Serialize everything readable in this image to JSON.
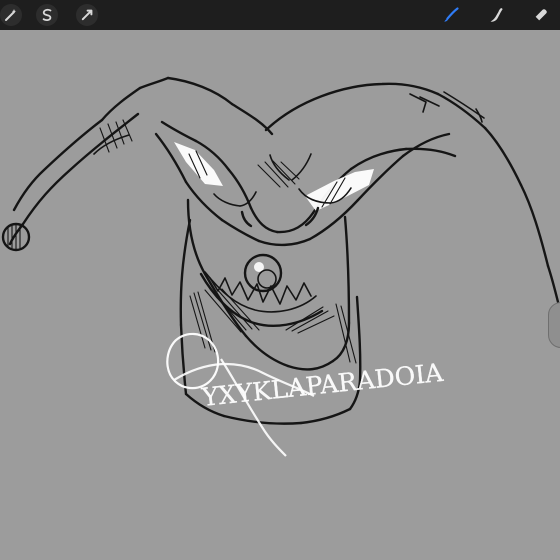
{
  "app": {
    "toolbar": {
      "left_tools": [
        {
          "name": "adjustments-icon"
        },
        {
          "name": "selection-icon"
        },
        {
          "name": "transform-icon"
        }
      ],
      "right_tools": [
        {
          "name": "brush-icon",
          "active": true
        },
        {
          "name": "smudge-icon"
        },
        {
          "name": "eraser-icon"
        }
      ]
    },
    "colors": {
      "toolbar_bg": "#1e1e1e",
      "canvas_bg": "#9c9c9c",
      "accent_blue": "#2f7cf6",
      "ink": "#151515",
      "watermark": "#ffffff"
    },
    "canvas": {
      "watermark_text": "YXYKLAPARADOIA"
    }
  }
}
